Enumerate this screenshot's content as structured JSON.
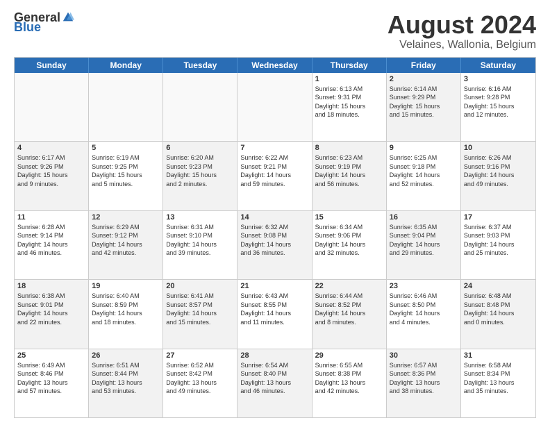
{
  "header": {
    "logo_general": "General",
    "logo_blue": "Blue",
    "title": "August 2024",
    "subtitle": "Velaines, Wallonia, Belgium"
  },
  "calendar": {
    "days": [
      "Sunday",
      "Monday",
      "Tuesday",
      "Wednesday",
      "Thursday",
      "Friday",
      "Saturday"
    ],
    "weeks": [
      [
        {
          "num": "",
          "info": "",
          "empty": true
        },
        {
          "num": "",
          "info": "",
          "empty": true
        },
        {
          "num": "",
          "info": "",
          "empty": true
        },
        {
          "num": "",
          "info": "",
          "empty": true
        },
        {
          "num": "1",
          "info": "Sunrise: 6:13 AM\nSunset: 9:31 PM\nDaylight: 15 hours\nand 18 minutes.",
          "empty": false
        },
        {
          "num": "2",
          "info": "Sunrise: 6:14 AM\nSunset: 9:29 PM\nDaylight: 15 hours\nand 15 minutes.",
          "empty": false
        },
        {
          "num": "3",
          "info": "Sunrise: 6:16 AM\nSunset: 9:28 PM\nDaylight: 15 hours\nand 12 minutes.",
          "empty": false
        }
      ],
      [
        {
          "num": "4",
          "info": "Sunrise: 6:17 AM\nSunset: 9:26 PM\nDaylight: 15 hours\nand 9 minutes.",
          "empty": false
        },
        {
          "num": "5",
          "info": "Sunrise: 6:19 AM\nSunset: 9:25 PM\nDaylight: 15 hours\nand 5 minutes.",
          "empty": false
        },
        {
          "num": "6",
          "info": "Sunrise: 6:20 AM\nSunset: 9:23 PM\nDaylight: 15 hours\nand 2 minutes.",
          "empty": false
        },
        {
          "num": "7",
          "info": "Sunrise: 6:22 AM\nSunset: 9:21 PM\nDaylight: 14 hours\nand 59 minutes.",
          "empty": false
        },
        {
          "num": "8",
          "info": "Sunrise: 6:23 AM\nSunset: 9:19 PM\nDaylight: 14 hours\nand 56 minutes.",
          "empty": false
        },
        {
          "num": "9",
          "info": "Sunrise: 6:25 AM\nSunset: 9:18 PM\nDaylight: 14 hours\nand 52 minutes.",
          "empty": false
        },
        {
          "num": "10",
          "info": "Sunrise: 6:26 AM\nSunset: 9:16 PM\nDaylight: 14 hours\nand 49 minutes.",
          "empty": false
        }
      ],
      [
        {
          "num": "11",
          "info": "Sunrise: 6:28 AM\nSunset: 9:14 PM\nDaylight: 14 hours\nand 46 minutes.",
          "empty": false
        },
        {
          "num": "12",
          "info": "Sunrise: 6:29 AM\nSunset: 9:12 PM\nDaylight: 14 hours\nand 42 minutes.",
          "empty": false
        },
        {
          "num": "13",
          "info": "Sunrise: 6:31 AM\nSunset: 9:10 PM\nDaylight: 14 hours\nand 39 minutes.",
          "empty": false
        },
        {
          "num": "14",
          "info": "Sunrise: 6:32 AM\nSunset: 9:08 PM\nDaylight: 14 hours\nand 36 minutes.",
          "empty": false
        },
        {
          "num": "15",
          "info": "Sunrise: 6:34 AM\nSunset: 9:06 PM\nDaylight: 14 hours\nand 32 minutes.",
          "empty": false
        },
        {
          "num": "16",
          "info": "Sunrise: 6:35 AM\nSunset: 9:04 PM\nDaylight: 14 hours\nand 29 minutes.",
          "empty": false
        },
        {
          "num": "17",
          "info": "Sunrise: 6:37 AM\nSunset: 9:03 PM\nDaylight: 14 hours\nand 25 minutes.",
          "empty": false
        }
      ],
      [
        {
          "num": "18",
          "info": "Sunrise: 6:38 AM\nSunset: 9:01 PM\nDaylight: 14 hours\nand 22 minutes.",
          "empty": false
        },
        {
          "num": "19",
          "info": "Sunrise: 6:40 AM\nSunset: 8:59 PM\nDaylight: 14 hours\nand 18 minutes.",
          "empty": false
        },
        {
          "num": "20",
          "info": "Sunrise: 6:41 AM\nSunset: 8:57 PM\nDaylight: 14 hours\nand 15 minutes.",
          "empty": false
        },
        {
          "num": "21",
          "info": "Sunrise: 6:43 AM\nSunset: 8:55 PM\nDaylight: 14 hours\nand 11 minutes.",
          "empty": false
        },
        {
          "num": "22",
          "info": "Sunrise: 6:44 AM\nSunset: 8:52 PM\nDaylight: 14 hours\nand 8 minutes.",
          "empty": false
        },
        {
          "num": "23",
          "info": "Sunrise: 6:46 AM\nSunset: 8:50 PM\nDaylight: 14 hours\nand 4 minutes.",
          "empty": false
        },
        {
          "num": "24",
          "info": "Sunrise: 6:48 AM\nSunset: 8:48 PM\nDaylight: 14 hours\nand 0 minutes.",
          "empty": false
        }
      ],
      [
        {
          "num": "25",
          "info": "Sunrise: 6:49 AM\nSunset: 8:46 PM\nDaylight: 13 hours\nand 57 minutes.",
          "empty": false
        },
        {
          "num": "26",
          "info": "Sunrise: 6:51 AM\nSunset: 8:44 PM\nDaylight: 13 hours\nand 53 minutes.",
          "empty": false
        },
        {
          "num": "27",
          "info": "Sunrise: 6:52 AM\nSunset: 8:42 PM\nDaylight: 13 hours\nand 49 minutes.",
          "empty": false
        },
        {
          "num": "28",
          "info": "Sunrise: 6:54 AM\nSunset: 8:40 PM\nDaylight: 13 hours\nand 46 minutes.",
          "empty": false
        },
        {
          "num": "29",
          "info": "Sunrise: 6:55 AM\nSunset: 8:38 PM\nDaylight: 13 hours\nand 42 minutes.",
          "empty": false
        },
        {
          "num": "30",
          "info": "Sunrise: 6:57 AM\nSunset: 8:36 PM\nDaylight: 13 hours\nand 38 minutes.",
          "empty": false
        },
        {
          "num": "31",
          "info": "Sunrise: 6:58 AM\nSunset: 8:34 PM\nDaylight: 13 hours\nand 35 minutes.",
          "empty": false
        }
      ]
    ]
  }
}
